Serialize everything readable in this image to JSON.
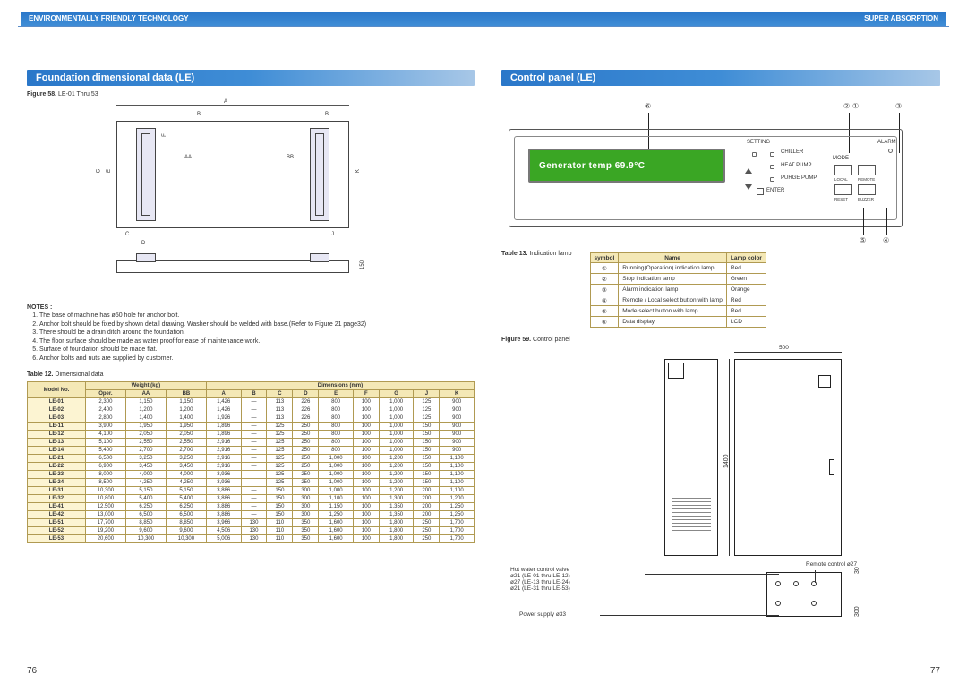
{
  "header": {
    "left": "ENVIRONMENTALLY FRIENDLY TECHNOLOGY",
    "right": "SUPER ABSORPTION"
  },
  "pages": {
    "left": "76",
    "right": "77"
  },
  "left_section": {
    "title": "Foundation dimensional data (LE)",
    "figure58": {
      "label": "Figure 58.",
      "text": "LE-01 Thru 53"
    },
    "drawing_labels": {
      "A": "A",
      "B": "B",
      "C": "C",
      "D": "D",
      "E": "E",
      "F": "F",
      "G": "G",
      "J": "J",
      "K": "K",
      "AA": "AA",
      "BB": "BB",
      "pipe_d": "150"
    },
    "notes_title": "NOTES :",
    "notes": [
      "The base of machine has ø50 hole for anchor bolt.",
      "Anchor bolt should be fixed by shown detail drawing. Washer should be welded with base.(Refer to Figure 21 page32)",
      "There should be a drain ditch around the foundation.",
      "The floor surface should be made as water proof for ease of maintenance work.",
      "Surface of foundation should be made flat.",
      "Anchor bolts and nuts are supplied by customer."
    ],
    "table12_caption_label": "Table 12.",
    "table12_caption_text": "Dimensional data",
    "dim_headers_group": {
      "model": "Model No.",
      "weight": "Weight (kg)",
      "dims": "Dimensions (mm)"
    },
    "dim_headers": [
      "Oper.",
      "AA",
      "BB",
      "A",
      "B",
      "C",
      "D",
      "E",
      "F",
      "G",
      "J",
      "K"
    ],
    "dim_rows": [
      {
        "model": "LE-01",
        "v": [
          "2,300",
          "1,150",
          "1,150",
          "1,426",
          "—",
          "113",
          "226",
          "800",
          "100",
          "1,000",
          "125",
          "900"
        ]
      },
      {
        "model": "LE-02",
        "v": [
          "2,400",
          "1,200",
          "1,200",
          "1,426",
          "—",
          "113",
          "226",
          "800",
          "100",
          "1,000",
          "125",
          "900"
        ]
      },
      {
        "model": "LE-03",
        "v": [
          "2,800",
          "1,400",
          "1,400",
          "1,926",
          "—",
          "113",
          "226",
          "800",
          "100",
          "1,000",
          "125",
          "900"
        ]
      },
      {
        "model": "LE-11",
        "v": [
          "3,900",
          "1,950",
          "1,950",
          "1,896",
          "—",
          "125",
          "250",
          "800",
          "100",
          "1,000",
          "150",
          "900"
        ]
      },
      {
        "model": "LE-12",
        "v": [
          "4,100",
          "2,050",
          "2,050",
          "1,896",
          "—",
          "125",
          "250",
          "800",
          "100",
          "1,000",
          "150",
          "900"
        ]
      },
      {
        "model": "LE-13",
        "v": [
          "5,100",
          "2,550",
          "2,550",
          "2,916",
          "—",
          "125",
          "250",
          "800",
          "100",
          "1,000",
          "150",
          "900"
        ]
      },
      {
        "model": "LE-14",
        "v": [
          "5,400",
          "2,700",
          "2,700",
          "2,916",
          "—",
          "125",
          "250",
          "800",
          "100",
          "1,000",
          "150",
          "900"
        ]
      },
      {
        "model": "LE-21",
        "v": [
          "6,500",
          "3,250",
          "3,250",
          "2,916",
          "—",
          "125",
          "250",
          "1,000",
          "100",
          "1,200",
          "150",
          "1,100"
        ]
      },
      {
        "model": "LE-22",
        "v": [
          "6,900",
          "3,450",
          "3,450",
          "2,916",
          "—",
          "125",
          "250",
          "1,000",
          "100",
          "1,200",
          "150",
          "1,100"
        ]
      },
      {
        "model": "LE-23",
        "v": [
          "8,000",
          "4,000",
          "4,000",
          "3,936",
          "—",
          "125",
          "250",
          "1,000",
          "100",
          "1,200",
          "150",
          "1,100"
        ]
      },
      {
        "model": "LE-24",
        "v": [
          "8,500",
          "4,250",
          "4,250",
          "3,936",
          "—",
          "125",
          "250",
          "1,000",
          "100",
          "1,200",
          "150",
          "1,100"
        ]
      },
      {
        "model": "LE-31",
        "v": [
          "10,300",
          "5,150",
          "5,150",
          "3,886",
          "—",
          "150",
          "300",
          "1,000",
          "100",
          "1,200",
          "200",
          "1,100"
        ]
      },
      {
        "model": "LE-32",
        "v": [
          "10,800",
          "5,400",
          "5,400",
          "3,886",
          "—",
          "150",
          "300",
          "1,100",
          "100",
          "1,300",
          "200",
          "1,200"
        ]
      },
      {
        "model": "LE-41",
        "v": [
          "12,500",
          "6,250",
          "6,250",
          "3,886",
          "—",
          "150",
          "300",
          "1,150",
          "100",
          "1,350",
          "200",
          "1,250"
        ]
      },
      {
        "model": "LE-42",
        "v": [
          "13,000",
          "6,500",
          "6,500",
          "3,886",
          "—",
          "150",
          "300",
          "1,250",
          "100",
          "1,350",
          "200",
          "1,250"
        ]
      },
      {
        "model": "LE-51",
        "v": [
          "17,700",
          "8,850",
          "8,850",
          "3,966",
          "130",
          "110",
          "350",
          "1,600",
          "100",
          "1,800",
          "250",
          "1,700"
        ]
      },
      {
        "model": "LE-52",
        "v": [
          "19,200",
          "9,600",
          "9,600",
          "4,506",
          "130",
          "110",
          "350",
          "1,600",
          "100",
          "1,800",
          "250",
          "1,700"
        ]
      },
      {
        "model": "LE-53",
        "v": [
          "20,600",
          "10,300",
          "10,300",
          "5,006",
          "130",
          "110",
          "350",
          "1,600",
          "100",
          "1,800",
          "250",
          "1,700"
        ]
      }
    ]
  },
  "right_section": {
    "title": "Control panel (LE)",
    "lcd_text": "Generator temp   69.9°C",
    "callouts": {
      "c1": "①",
      "c2": "②",
      "c3": "③",
      "c4": "④",
      "c5": "⑤",
      "c6": "⑥"
    },
    "panel_small_labels": {
      "setting": "SETTING",
      "chiller": "CHILLER",
      "alarm": "ALARM",
      "heat_pump": "HEAT PUMP",
      "purge_pump": "PURGE PUMP",
      "mode": "MODE",
      "local": "LOCAL",
      "remote": "REMOTE",
      "reset": "RESET",
      "buzzer": "BUZZER",
      "enter": "ENTER"
    },
    "table13_caption_label": "Table 13.",
    "table13_caption_text": "Indication lamp",
    "lamp_headers": [
      "symbol",
      "Name",
      "Lamp color"
    ],
    "lamp_rows": [
      {
        "sym": "①",
        "name": "Running(Operation) indication lamp",
        "color": "Red"
      },
      {
        "sym": "②",
        "name": "Stop indication lamp",
        "color": "Green"
      },
      {
        "sym": "③",
        "name": "Alarm indication lamp",
        "color": "Orange"
      },
      {
        "sym": "④",
        "name": "Remote / Local select button with lamp",
        "color": "Red"
      },
      {
        "sym": "⑤",
        "name": "Mode select button with lamp",
        "color": "Red"
      },
      {
        "sym": "⑥",
        "name": "Data display",
        "color": "LCD"
      }
    ],
    "figure59": {
      "label": "Figure 59.",
      "text": "Control panel"
    },
    "cabinet": {
      "width_top": "500",
      "height": "1400",
      "box_h": "300",
      "box_offset": "30",
      "hot_water": "Hot water control valve",
      "hw1": "ø21 (LE-01 thru LE-12)",
      "hw2": "ø27 (LE-13 thru LE-24)",
      "hw3": "ø21 (LE-31 thru LE-53)",
      "remote": "Remote control ø27",
      "power": "Power supply ø33"
    }
  }
}
